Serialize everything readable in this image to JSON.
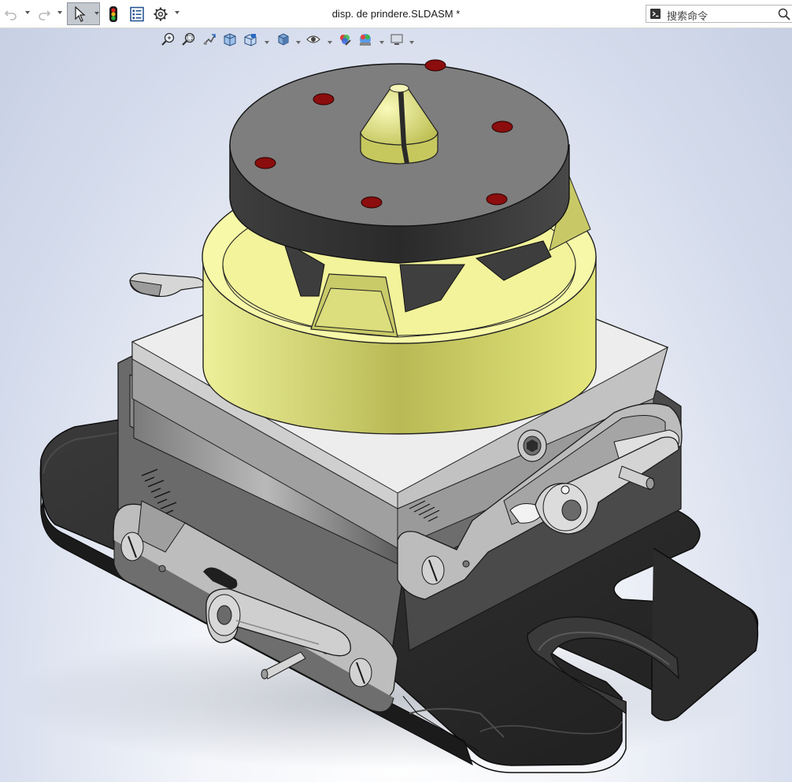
{
  "window": {
    "document_title": "disp. de prindere.SLDASM *"
  },
  "toolbar": {
    "undo_icon": "undo-icon",
    "redo_icon": "redo-icon",
    "select_icon": "select-arrow-icon",
    "rebuild_icon": "traffic-light-icon",
    "file_properties_icon": "file-properties-icon",
    "options_icon": "gear-icon"
  },
  "search": {
    "placeholder": "搜索命令"
  },
  "heads_up_toolbar": {
    "items": [
      "zoom-to-fit-icon",
      "zoom-to-area-icon",
      "previous-view-icon",
      "section-view-icon",
      "view-orientation-icon",
      "display-style-icon",
      "hide-show-items-icon",
      "edit-appearance-icon",
      "apply-scene-icon",
      "view-settings-icon"
    ]
  },
  "colors": {
    "accent_yellow": "#f1f29a",
    "dark_steel": "#3f3f3f",
    "base_black": "#2b2b2b",
    "red_holes": "#8b0d0d",
    "light_steel": "#e6e6e6"
  }
}
